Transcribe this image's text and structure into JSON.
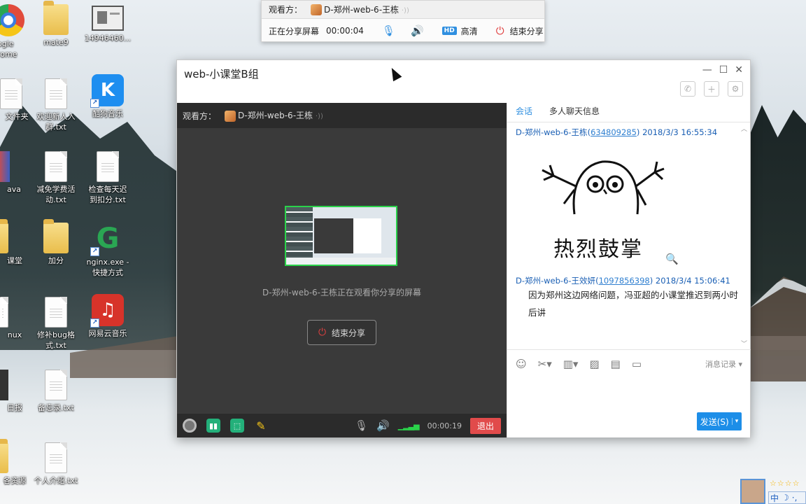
{
  "desktop": {
    "icons": [
      {
        "id": "chrome",
        "label": "ogle\nrome"
      },
      {
        "id": "mate9",
        "label": "mate9"
      },
      {
        "id": "photo",
        "label": "14946460..."
      },
      {
        "id": "folder1",
        "label": "文件夹"
      },
      {
        "id": "welcome",
        "label": "欢迎新人入\n群.txt"
      },
      {
        "id": "kugou",
        "label": "酷狗音乐"
      },
      {
        "id": "java",
        "label": "ava"
      },
      {
        "id": "tuition",
        "label": "减免学费活\n动.txt"
      },
      {
        "id": "checkin",
        "label": "检查每天迟\n到扣分.txt"
      },
      {
        "id": "classroom",
        "label": "课堂"
      },
      {
        "id": "bonus",
        "label": "加分"
      },
      {
        "id": "nginx",
        "label": "nginx.exe -\n快捷方式"
      },
      {
        "id": "linux",
        "label": "nux"
      },
      {
        "id": "bugfix",
        "label": "修补bug格\n式.txt"
      },
      {
        "id": "netease",
        "label": "网易云音乐"
      },
      {
        "id": "daily",
        "label": "日报"
      },
      {
        "id": "memo",
        "label": "备忘录.txt"
      },
      {
        "id": "resources",
        "label": "各资源"
      },
      {
        "id": "intro",
        "label": "个人介绍.txt"
      }
    ]
  },
  "sharebar": {
    "viewer_label": "观看方：",
    "viewer_name": "D-郑州-web-6-王栋",
    "sharing_label": "正在分享屏幕",
    "timer": "00:00:04",
    "hd_badge": "HD",
    "hd_label": "高清",
    "end_label": "结束分享"
  },
  "window": {
    "title": "web-小课堂B组",
    "share": {
      "viewer_label": "观看方：",
      "viewer_name": "D-郑州-web-6-王栋",
      "watching_text": "D-郑州-web-6-王栋正在观看你分享的屏幕",
      "end_button": "结束分享",
      "timer": "00:00:19",
      "exit_button": "退出"
    },
    "chat": {
      "tabs": [
        "会话",
        "多人聊天信息"
      ],
      "messages": [
        {
          "sender": "D-郑州-web-6-王栋",
          "qq": "634809285",
          "time": "2018/3/3 16:55:34",
          "sticker_text": "热烈鼓掌"
        },
        {
          "sender": "D-郑州-web-6-王效妍",
          "qq": "1097856398",
          "time": "2018/3/4 15:06:41",
          "body": "因为郑州这边网络问题，冯亚超的小课堂推迟到两小时后讲"
        }
      ],
      "history_label": "消息记录",
      "send_button": "发送(S)"
    }
  },
  "tray": {
    "ime": "中"
  },
  "colors": {
    "accent": "#2f8fe0",
    "danger": "#e14b4b",
    "signal": "#2ad24a"
  }
}
